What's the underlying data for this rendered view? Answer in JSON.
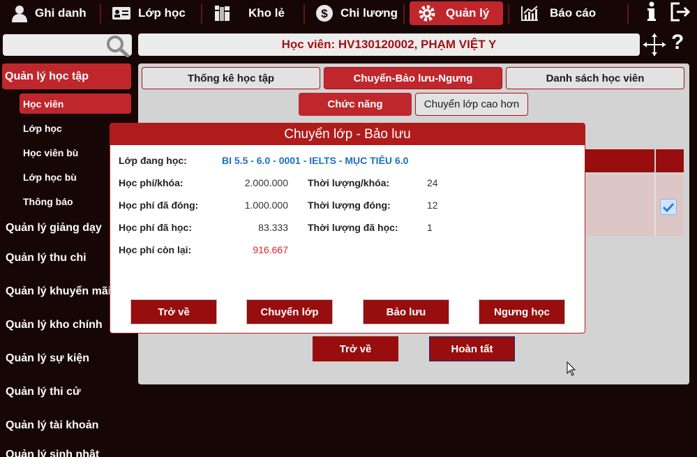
{
  "nav": {
    "items": [
      {
        "label": "Ghi danh",
        "icon": "user-icon"
      },
      {
        "label": "Lớp học",
        "icon": "id-card-icon"
      },
      {
        "label": "Kho lẻ",
        "icon": "books-icon"
      },
      {
        "label": "Chi lương",
        "icon": "dollar-icon"
      },
      {
        "label": "Quản lý",
        "icon": "gear-icon"
      },
      {
        "label": "Báo cáo",
        "icon": "chart-icon"
      }
    ],
    "active": "Quản lý"
  },
  "student": {
    "title": "Học viên: HV130120002, PHẠM VIỆT Y"
  },
  "sidebar": {
    "section_active": "Quản lý học tập",
    "sub_items": [
      "Học viên",
      "Lớp học",
      "Học viên bù",
      "Lớp học bù",
      "Thông báo"
    ],
    "sections": [
      "Quản lý giảng dạy",
      "Quản lý thu chi",
      "Quản lý khuyến mãi",
      "Quản lý kho chính",
      "Quản lý sự kiện",
      "Quản lý thi cử",
      "Quản lý tài khoản",
      "Quản lý sinh nhật"
    ]
  },
  "tabs": [
    "Thống kê học tập",
    "Chuyển-Bảo lưu-Ngưng",
    "Danh sách học viên"
  ],
  "subtabs": [
    "Chức năng",
    "Chuyển lớp cao hơn"
  ],
  "footer_buttons": {
    "back": "Trở về",
    "done": "Hoàn tất"
  },
  "modal": {
    "title": "Chuyển lớp - Bảo lưu",
    "current_class_label": "Lớp đang học:",
    "current_class_value": "BI 5.5 - 6.0 - 0001 - IELTS - MỤC TIÊU 6.0",
    "fees": [
      {
        "label": "Học phí/khóa:",
        "value": "2.000.000"
      },
      {
        "label": "Học phí đã đóng:",
        "value": "1.000.000"
      },
      {
        "label": "Học phí đã học:",
        "value": "83.333"
      },
      {
        "label": "Học phí còn lại:",
        "value": "916.667"
      }
    ],
    "durations": [
      {
        "label": "Thời lượng/khóa:",
        "value": "24"
      },
      {
        "label": "Thời lượng đóng:",
        "value": "12"
      },
      {
        "label": "Thời lượng đã học:",
        "value": "1"
      }
    ],
    "buttons": [
      "Trở về",
      "Chuyển lớp",
      "Bảo lưu",
      "Ngưng học"
    ]
  },
  "colors": {
    "accent": "#c0272d",
    "dark_button": "#980d0d",
    "background": "#170606",
    "remaining_fee": "#e0242a",
    "course_link": "#1a6fc0"
  }
}
